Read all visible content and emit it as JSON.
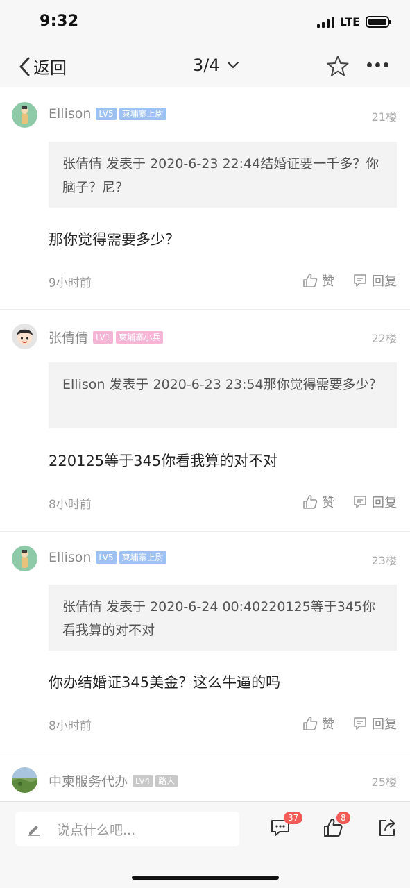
{
  "status_bar": {
    "time": "9:32",
    "network": "LTE"
  },
  "nav": {
    "back_label": "返回",
    "page_indicator": "3/4"
  },
  "posts": [
    {
      "username": "Ellison",
      "level": "LV5",
      "title_badge": "柬埔寨上尉",
      "floor": "21楼",
      "quote": "张倩倩 发表于 2020-6-23 22:44结婚证要一千多？你脑子？尼？",
      "content": "那你觉得需要多少？",
      "time": "9小时前",
      "like_label": "赞",
      "reply_label": "回复"
    },
    {
      "username": "张倩倩",
      "level": "LV1",
      "title_badge": "柬埔寨小兵",
      "floor": "22楼",
      "quote": "Ellison 发表于 2020-6-23 23:54那你觉得需要多少？",
      "content": "220125等于345你看我算的对不对",
      "time": "8小时前",
      "like_label": "赞",
      "reply_label": "回复"
    },
    {
      "username": "Ellison",
      "level": "LV5",
      "title_badge": "柬埔寨上尉",
      "floor": "23楼",
      "quote": "张倩倩 发表于 2020-6-24 00:40220125等于345你看我算的对不对",
      "content": "你办结婚证345美金？这么牛逼的吗",
      "time": "8小时前",
      "like_label": "赞",
      "reply_label": "回复"
    },
    {
      "username": "中柬服务代办",
      "level": "LV4",
      "title_badge": "路人",
      "floor": "25楼"
    }
  ],
  "bottom_bar": {
    "comment_placeholder": "说点什么吧...",
    "comment_count": "37",
    "like_count": "8"
  },
  "icons": [
    "back-chevron-icon",
    "dropdown-chevron-icon",
    "star-icon",
    "more-icon",
    "thumb-up-icon",
    "reply-icon",
    "pen-icon",
    "comment-icon",
    "like-icon",
    "share-icon"
  ]
}
